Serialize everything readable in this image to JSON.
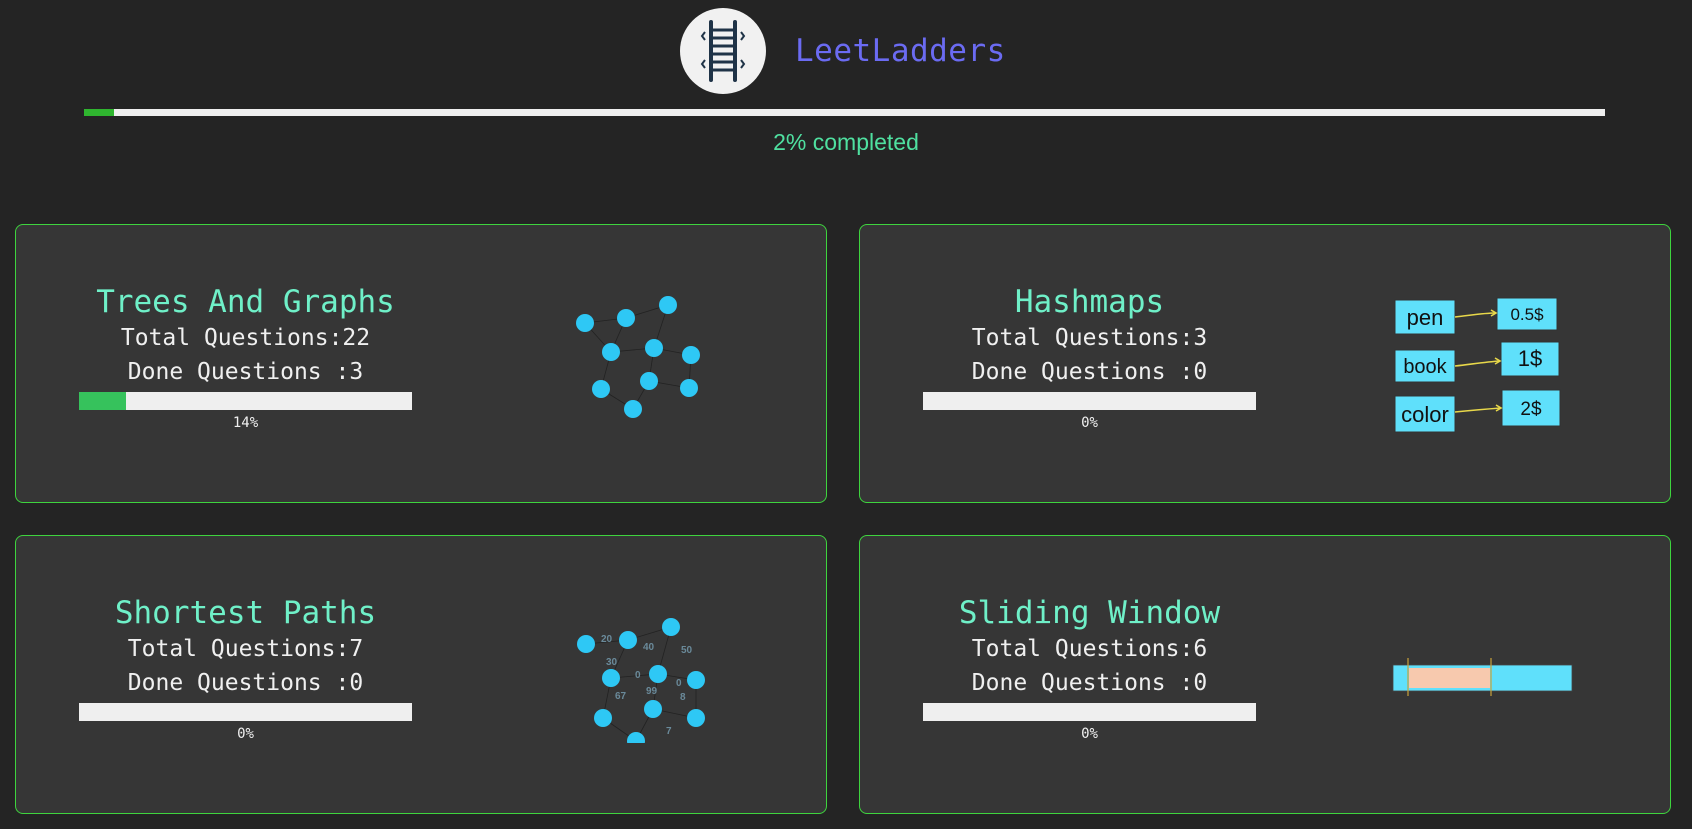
{
  "header": {
    "brand": "LeetLadders",
    "progress_percent": 2,
    "progress_label": "2% completed",
    "logo_icon": "ladder-icon"
  },
  "colors": {
    "background": "#242424",
    "card_background": "#363636",
    "card_border": "#3ed43e",
    "title": "#6ff0c8",
    "brand": "#6b6bf2",
    "progress_fill": "#36c25c",
    "node": "#2ec8f5"
  },
  "cards": [
    {
      "title": "Trees And Graphs",
      "total_label": "Total Questions:22",
      "done_label": "Done Questions :3",
      "progress_percent": 14,
      "progress_label": "14%",
      "illustration": "graph-illustration"
    },
    {
      "title": "Hashmaps",
      "total_label": "Total Questions:3",
      "done_label": "Done Questions :0",
      "progress_percent": 0,
      "progress_label": "0%",
      "illustration": "hashmap-illustration",
      "hashmap": {
        "keys": [
          "pen",
          "book",
          "color"
        ],
        "values": [
          "0.5$",
          "1$",
          "2$"
        ]
      }
    },
    {
      "title": "Shortest Paths",
      "total_label": "Total Questions:7",
      "done_label": "Done Questions :0",
      "progress_percent": 0,
      "progress_label": "0%",
      "illustration": "weighted-graph-illustration",
      "weights": [
        "20",
        "40",
        "50",
        "30",
        "0",
        "0",
        "99",
        "67",
        "8",
        "7"
      ]
    },
    {
      "title": "Sliding Window",
      "total_label": "Total Questions:6",
      "done_label": "Done Questions :0",
      "progress_percent": 0,
      "progress_label": "0%",
      "illustration": "sliding-window-illustration"
    }
  ]
}
